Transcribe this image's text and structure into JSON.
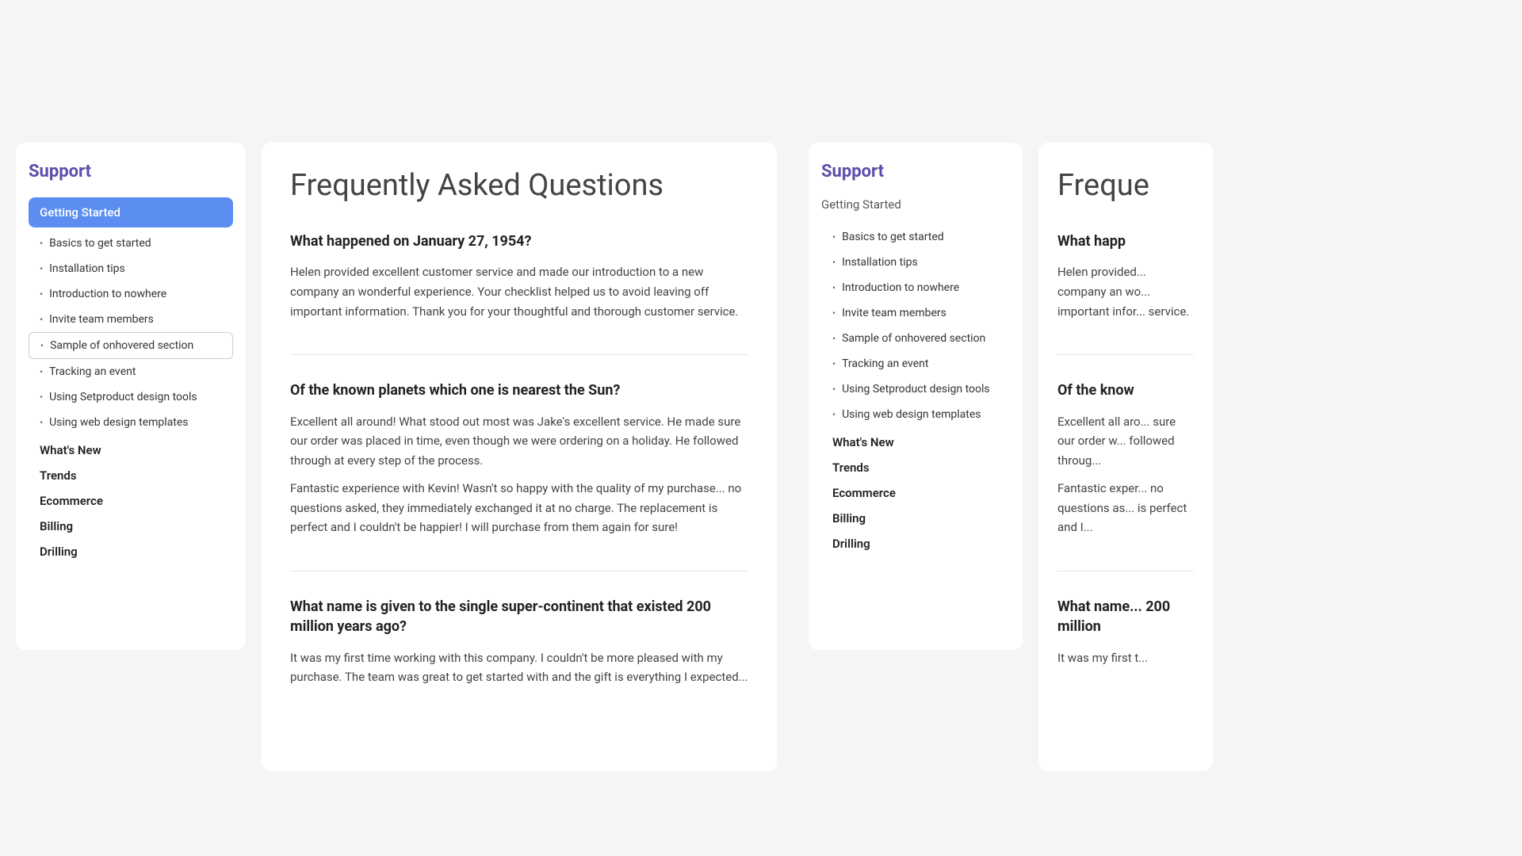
{
  "colors": {
    "accent": "#5c4eab",
    "activeNav": "#5b8ef0",
    "text": "#333",
    "faqTitle": "#555"
  },
  "panel1": {
    "sidebar": {
      "title": "Support",
      "activeSection": "Getting Started",
      "subItems": [
        "Basics to get started",
        "Installation tips",
        "Introduction to nowhere",
        "Invite team members",
        "Sample of onhovered section",
        "Tracking an event",
        "Using Setproduct design tools",
        "Using web design templates"
      ],
      "sections": [
        "What's New",
        "Trends",
        "Ecommerce",
        "Billing",
        "Drilling"
      ]
    },
    "faq": {
      "title": "Frequently Asked Questions",
      "items": [
        {
          "question": "What happened on January 27, 1954?",
          "answers": [
            "Helen provided excellent customer service and made our introduction to a new company an wonderful experience. Your checklist helped us to avoid leaving off important information. Thank you for your thoughtful and thorough customer service."
          ]
        },
        {
          "question": "Of the known planets which one is nearest the Sun?",
          "answers": [
            "Excellent all around! What stood out most was Jake's excellent service. He made sure our order was placed in time, even though we were ordering on a holiday. He followed through at every step of the process.",
            "Fantastic experience with Kevin! Wasn't so happy with the quality of my purchase... no questions asked, they immediately exchanged it at no charge. The replacement is perfect and I couldn't be happier! I will purchase from them again for sure!"
          ]
        },
        {
          "question": "What name is given to the single super-continent that existed 200 million years ago?",
          "answers": [
            "It was my first time working with this company. I couldn't be more pleased with my purchase. The team was great to get started with and the gift is everything I expected..."
          ]
        }
      ]
    }
  },
  "panel2": {
    "sidebar": {
      "title": "Support",
      "activeSection": "Getting Started",
      "subItems": [
        "Basics to get started",
        "Installation tips",
        "Introduction to nowhere",
        "Invite team members",
        "Sample of onhovered section",
        "Tracking an event",
        "Using Setproduct design tools",
        "Using web design templates"
      ],
      "sections": [
        "What's New",
        "Trends",
        "Ecommerce",
        "Billing",
        "Drilling"
      ]
    },
    "faq": {
      "title": "Freque",
      "items": [
        {
          "question": "What happ",
          "answers": [
            "Helen provided... company an wo... important infor... service."
          ]
        },
        {
          "question": "Of the know",
          "answers": [
            "Excellent all aro... sure our order w... followed throug...",
            "Fantastic exper... no questions as... is perfect and I..."
          ]
        },
        {
          "question": "What name... 200 million",
          "answers": [
            "It was my first t..."
          ]
        }
      ]
    }
  }
}
